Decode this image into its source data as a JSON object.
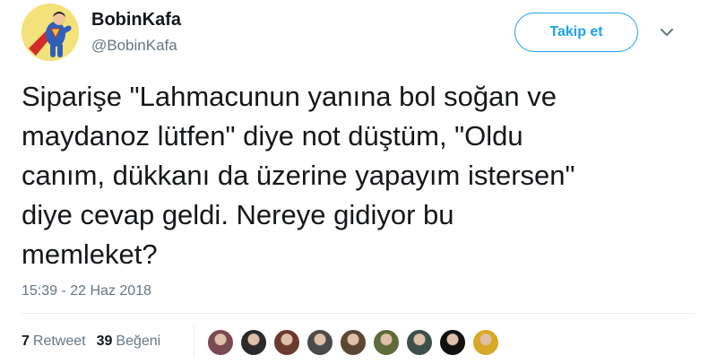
{
  "tweet": {
    "author": {
      "name": "BobinKafa",
      "handle": "@BobinKafa",
      "avatar_icon": "superman-avatar-icon"
    },
    "follow_label": "Takip et",
    "menu_icon": "chevron-down-icon",
    "text": "Siparişe \"Lahmacunun yanına bol soğan ve\nmaydanoz lütfen\" diye not düştüm, \"Oldu\ncanım, dükkanı da üzerine yapayım istersen\"\ndiye cevap geldi. Nereye gidiyor bu\nmemleket?",
    "timestamp": "15:39 - 22 Haz 2018",
    "retweets": {
      "count": "7",
      "label": "Retweet"
    },
    "likes": {
      "count": "39",
      "label": "Beğeni"
    },
    "likers": [
      {
        "icon": "user-avatar-icon",
        "color": "#7a4a52"
      },
      {
        "icon": "user-avatar-icon",
        "color": "#2c2a2c"
      },
      {
        "icon": "user-avatar-icon",
        "color": "#6b3a2e"
      },
      {
        "icon": "user-avatar-icon",
        "color": "#4a4a4a"
      },
      {
        "icon": "user-avatar-icon",
        "color": "#5a4632"
      },
      {
        "icon": "user-avatar-icon",
        "color": "#5f6b3a"
      },
      {
        "icon": "user-avatar-icon",
        "color": "#3d4f4a"
      },
      {
        "icon": "user-avatar-icon",
        "color": "#111111"
      },
      {
        "icon": "user-avatar-icon",
        "color": "#d8a826"
      }
    ]
  },
  "colors": {
    "accent": "#1da1f2",
    "text": "#14171a",
    "secondary": "#657786",
    "divider": "#e6ecf0"
  }
}
